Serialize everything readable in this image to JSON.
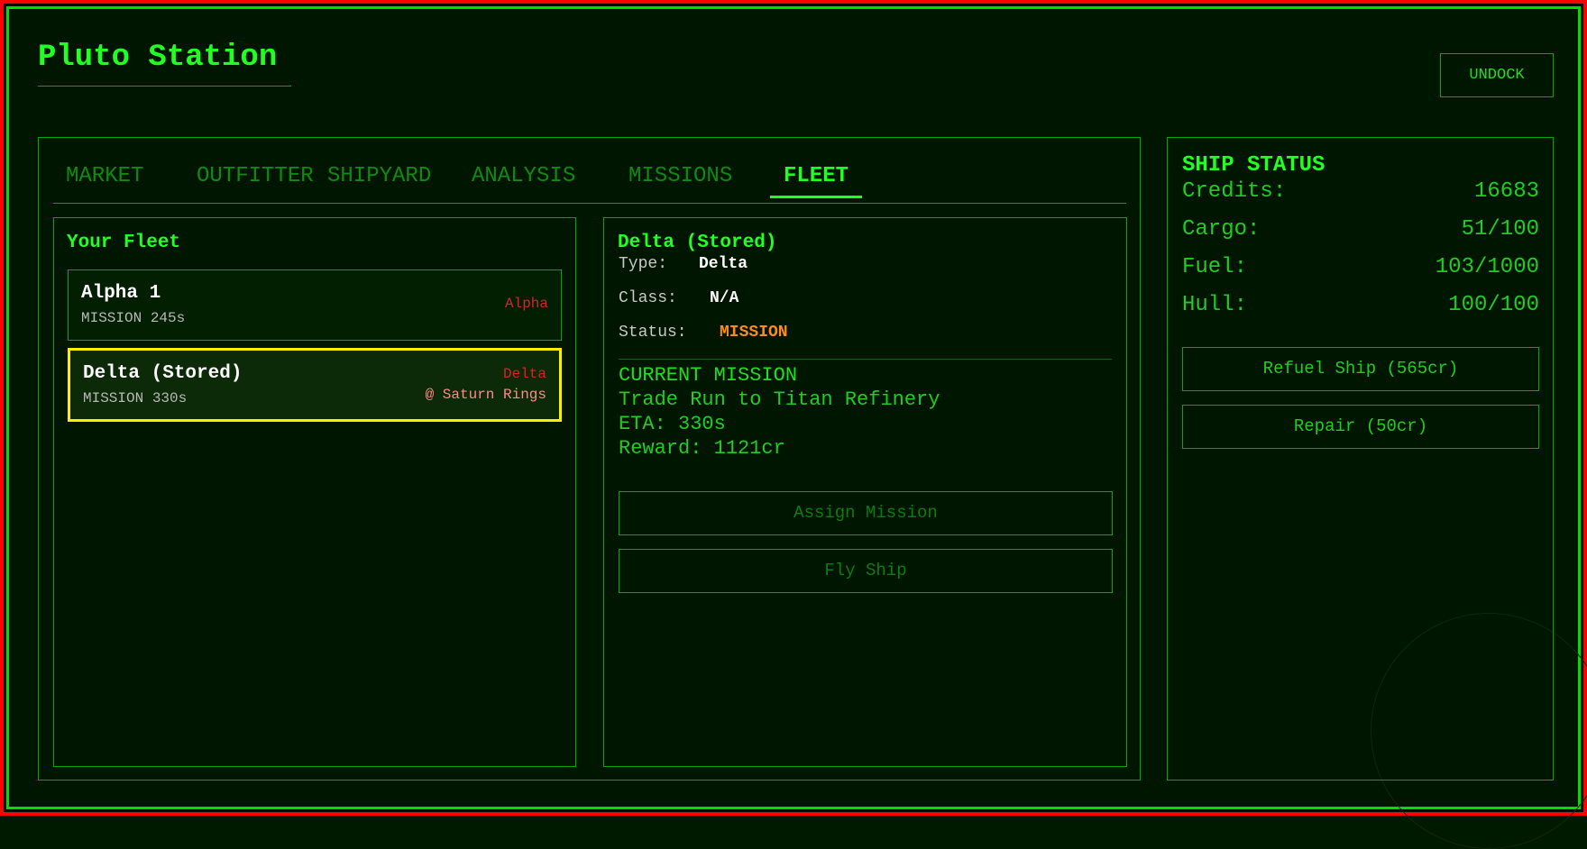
{
  "station": {
    "title": "Pluto Station",
    "undock_label": "UNDOCK"
  },
  "tabs": [
    {
      "label": "MARKET",
      "active": false
    },
    {
      "label": "OUTFITTER",
      "active": false
    },
    {
      "label": "SHIPYARD",
      "active": false
    },
    {
      "label": "ANALYSIS",
      "active": false
    },
    {
      "label": "MISSIONS",
      "active": false
    },
    {
      "label": "FLEET",
      "active": true
    }
  ],
  "fleet": {
    "heading": "Your Fleet",
    "ships": [
      {
        "name": "Alpha 1",
        "status": "MISSION 245s",
        "type": "Alpha",
        "location": "",
        "selected": false
      },
      {
        "name": "Delta (Stored)",
        "status": "MISSION 330s",
        "type": "Delta",
        "location": "@ Saturn Rings",
        "selected": true
      }
    ]
  },
  "detail": {
    "heading": "Delta (Stored)",
    "type_label": "Type:",
    "type_value": "Delta",
    "class_label": "Class:",
    "class_value": "N/A",
    "status_label": "Status:",
    "status_value": "MISSION",
    "mission_header": "CURRENT MISSION",
    "mission_name": "Trade Run to Titan Refinery",
    "mission_eta": "ETA: 330s",
    "mission_reward": "Reward: 1121cr",
    "assign_label": "Assign Mission",
    "fly_label": "Fly Ship"
  },
  "ship_status": {
    "heading": "SHIP STATUS",
    "credits_label": "Credits:",
    "credits_value": "16683",
    "cargo_label": "Cargo:",
    "cargo_value": "51/100",
    "fuel_label": "Fuel:",
    "fuel_value": "103/1000",
    "hull_label": "Hull:",
    "hull_value": "100/100",
    "refuel_label": "Refuel Ship (565cr)",
    "repair_label": "Repair (50cr)"
  },
  "colors": {
    "accent": "#22ff22",
    "border": "#00aa00",
    "background": "#001600",
    "outer_frame": "#ff0000",
    "selected": "#ffee00",
    "mission_status": "#ff8a1a",
    "ship_type": "#dd2222"
  }
}
